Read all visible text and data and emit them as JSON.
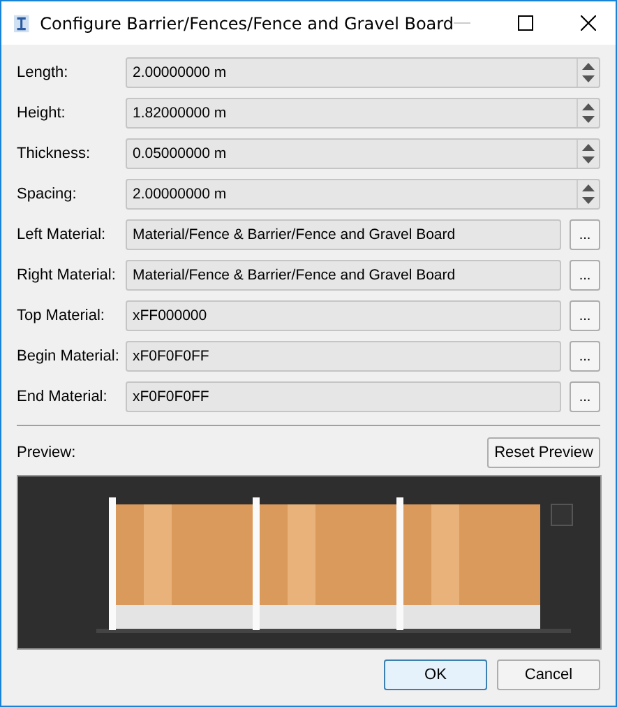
{
  "window": {
    "title": "Configure Barrier/Fences/Fence and Gravel Board"
  },
  "fields": [
    {
      "kind": "spin",
      "label": "Length:",
      "value": "2.00000000 m"
    },
    {
      "kind": "spin",
      "label": "Height:",
      "value": "1.82000000 m"
    },
    {
      "kind": "spin",
      "label": "Thickness:",
      "value": "0.05000000 m"
    },
    {
      "kind": "spin",
      "label": "Spacing:",
      "value": "2.00000000 m"
    },
    {
      "kind": "material",
      "label": "Left Material:",
      "value": "Material/Fence & Barrier/Fence and Gravel Board",
      "button": "..."
    },
    {
      "kind": "material",
      "label": "Right Material:",
      "value": "Material/Fence & Barrier/Fence and Gravel Board",
      "button": "..."
    },
    {
      "kind": "material",
      "label": "Top Material:",
      "value": "xFF000000",
      "button": "..."
    },
    {
      "kind": "material",
      "label": "Begin Material:",
      "value": "xF0F0F0FF",
      "button": "..."
    },
    {
      "kind": "material",
      "label": "End Material:",
      "value": "xF0F0F0FF",
      "button": "..."
    }
  ],
  "preview": {
    "label": "Preview:",
    "reset_button": "Reset Preview",
    "kind": "picture"
  },
  "buttons": [
    "OK",
    "Cancel"
  ]
}
